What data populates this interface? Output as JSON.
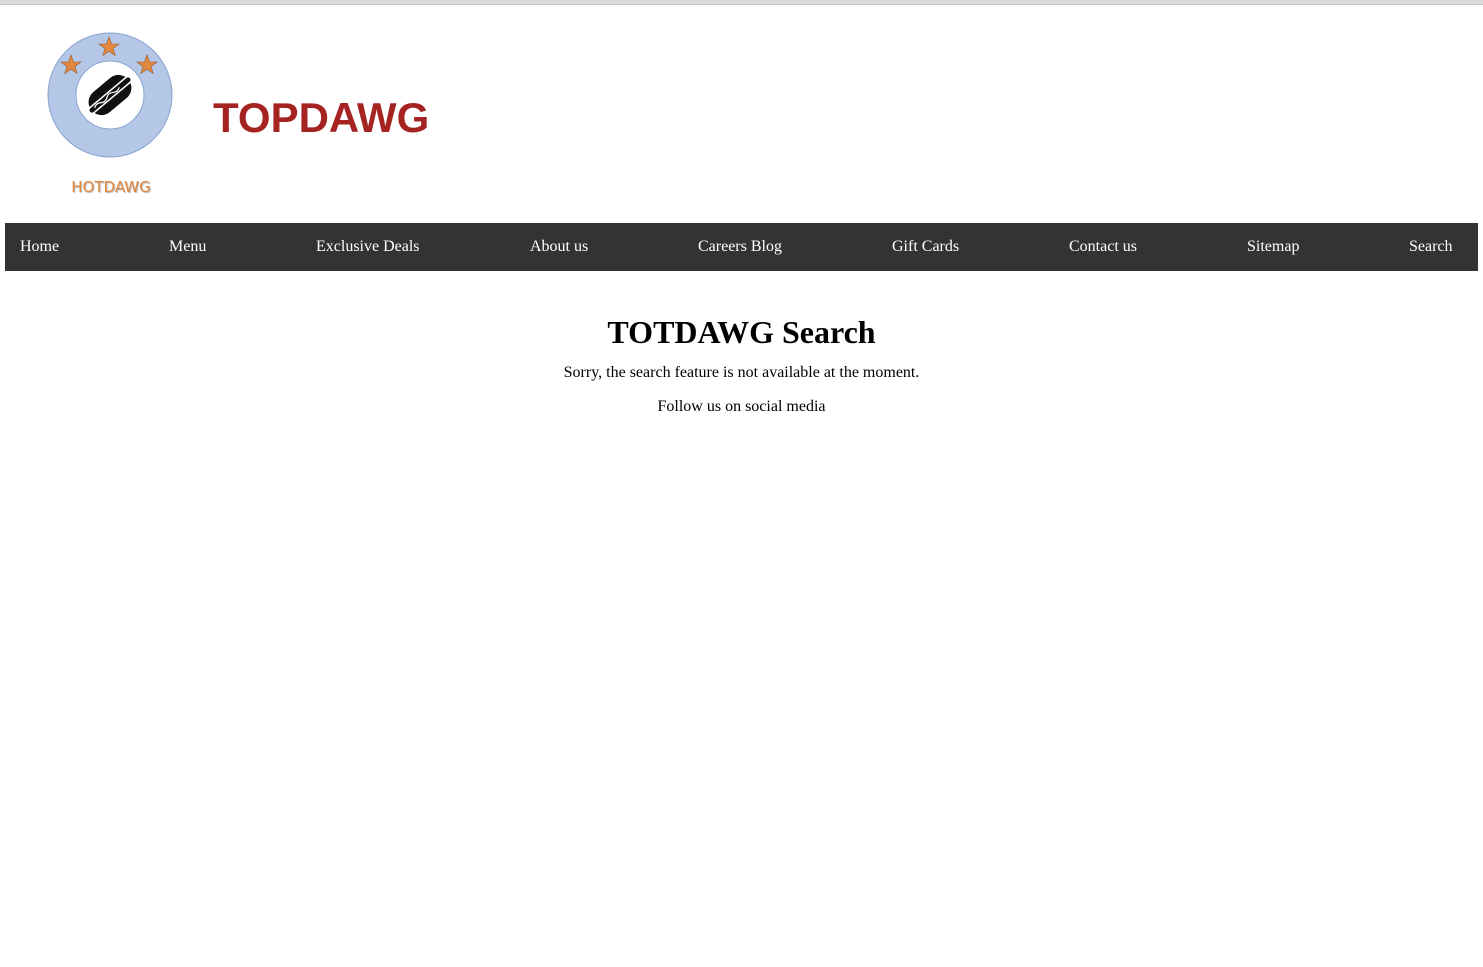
{
  "brand": {
    "logo_caption": "HOTDAWG",
    "site_title": "TOPDAWG",
    "title_color": "#a52422",
    "caption_color": "#e2893f",
    "logo_ring_color": "#b4c7e7",
    "star_color": "#e2893f"
  },
  "nav": {
    "background": "#333333",
    "items": [
      {
        "label": "Home"
      },
      {
        "label": "Menu"
      },
      {
        "label": "Exclusive Deals"
      },
      {
        "label": "About us"
      },
      {
        "label": "Careers Blog"
      },
      {
        "label": "Gift Cards"
      },
      {
        "label": "Contact us"
      },
      {
        "label": "Sitemap"
      },
      {
        "label": "Search"
      }
    ]
  },
  "main": {
    "heading": "TOTDAWG Search",
    "message": "Sorry, the search feature is not available at the moment.",
    "social_text": "Follow us on social media"
  }
}
